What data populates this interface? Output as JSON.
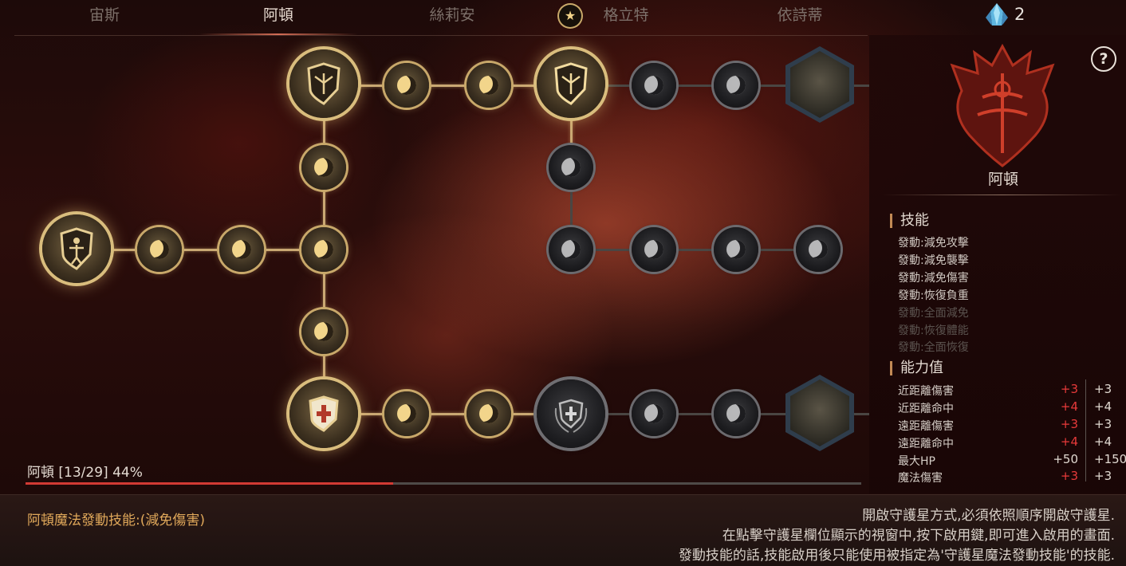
{
  "tabs": [
    {
      "label": "宙斯",
      "active": false
    },
    {
      "label": "阿頓",
      "active": true
    },
    {
      "label": "絲莉安",
      "active": false
    },
    {
      "label": "格立特",
      "active": false
    },
    {
      "label": "依詩蒂",
      "active": false
    }
  ],
  "currency": {
    "icon": "blue-crystal-icon",
    "count": "2"
  },
  "tree": {
    "progress_label": "阿頓 [13/29] 44%",
    "progress_fraction": 0.44,
    "unlocked_nodes": 13,
    "total_nodes": 29
  },
  "panel": {
    "help_label": "?",
    "hero_name": "阿頓",
    "skills_title": "技能",
    "skills": [
      {
        "label": "發動:減免攻擊",
        "unlocked": true
      },
      {
        "label": "發動:減免襲擊",
        "unlocked": true
      },
      {
        "label": "發動:減免傷害",
        "unlocked": true
      },
      {
        "label": "發動:恢復負重",
        "unlocked": true
      },
      {
        "label": "發動:全面減免",
        "unlocked": false
      },
      {
        "label": "發動:恢復體能",
        "unlocked": false
      },
      {
        "label": "發動:全面恢復",
        "unlocked": false
      }
    ],
    "stats_title": "能力值",
    "stats": [
      {
        "name": "近距離傷害",
        "bonus": "+3",
        "total": "+3",
        "bonus_red": true
      },
      {
        "name": "近距離命中",
        "bonus": "+4",
        "total": "+4",
        "bonus_red": true
      },
      {
        "name": "遠距離傷害",
        "bonus": "+3",
        "total": "+3",
        "bonus_red": true
      },
      {
        "name": "遠距離命中",
        "bonus": "+4",
        "total": "+4",
        "bonus_red": true
      },
      {
        "name": "最大HP",
        "bonus": "+50",
        "total": "+150",
        "bonus_red": false
      },
      {
        "name": "魔法傷害",
        "bonus": "+3",
        "total": "+3",
        "bonus_red": true
      }
    ]
  },
  "bottom": {
    "active_skill": "阿頓魔法發動技能:(減免傷害)",
    "info_lines": [
      "開啟守護星方式,必須依照順序開啟守護星.",
      "在點擊守護星欄位顯示的視窗中,按下啟用鍵,即可進入啟用的畫面.",
      "發動技能的話,技能啟用後只能使用被指定為'守護星魔法發動技能'的技能."
    ]
  },
  "colors": {
    "accent_gold": "#d9bd7d",
    "progress_red": "#d23a34",
    "stat_red": "#e83a3a"
  }
}
